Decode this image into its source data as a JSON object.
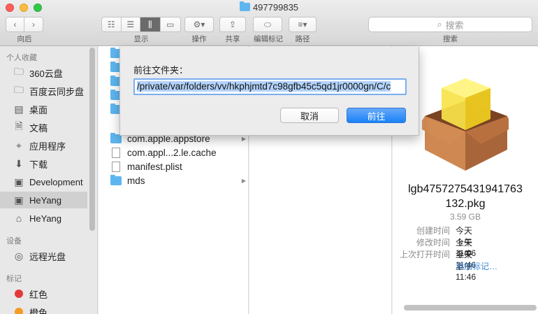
{
  "window": {
    "title": "497799835"
  },
  "toolbar": {
    "back_label": "向后",
    "view_label": "显示",
    "action_label": "操作",
    "share_label": "共享",
    "tags_label": "编辑标记",
    "path_label": "路径",
    "search_placeholder": "搜索",
    "search_label": "搜索"
  },
  "sidebar": {
    "favorites_header": "个人收藏",
    "favorites": [
      {
        "label": "360云盘",
        "icon": "folder-icon"
      },
      {
        "label": "百度云同步盘",
        "icon": "folder-icon"
      },
      {
        "label": "桌面",
        "icon": "desktop-icon"
      },
      {
        "label": "文稿",
        "icon": "documents-icon"
      },
      {
        "label": "应用程序",
        "icon": "applications-icon"
      },
      {
        "label": "下载",
        "icon": "downloads-icon"
      },
      {
        "label": "Development",
        "icon": "drive-icon"
      },
      {
        "label": "HeYang",
        "icon": "drive-icon",
        "selected": true
      },
      {
        "label": "HeYang",
        "icon": "home-icon"
      }
    ],
    "devices_header": "设备",
    "devices": [
      {
        "label": "远程光盘",
        "icon": "disc-icon"
      }
    ],
    "tags_header": "标记",
    "tags": [
      {
        "label": "红色",
        "color": "#e5383b"
      },
      {
        "label": "橙色",
        "color": "#f59a23"
      }
    ]
  },
  "column1": {
    "items": [
      {
        "label": "com.apple.appstore",
        "type": "folder",
        "has_children": true
      },
      {
        "label": "com.appl...2.le.cache",
        "type": "file"
      },
      {
        "label": "manifest.plist",
        "type": "file"
      },
      {
        "label": "mds",
        "type": "folder",
        "has_children": true
      }
    ]
  },
  "preview": {
    "name_line1": "lgb4757275431941763",
    "name_line2": "132.pkg",
    "size": "3.59 GB",
    "meta": [
      {
        "key": "创建时间",
        "value": "今天 上午11:06"
      },
      {
        "key": "修改时间",
        "value": "今天 上午11:46"
      },
      {
        "key": "上次打开时间",
        "value": "今天 上午11:46"
      }
    ],
    "add_tags": "添加标记…"
  },
  "dialog": {
    "label": "前往文件夹：",
    "path": "/private/var/folders/vv/hkphjmtd7c98gfb45c5qd1jr0000gn/C/c",
    "cancel": "取消",
    "go": "前往"
  },
  "colors": {
    "accent": "#1a82f7",
    "folder": "#5eb6f0",
    "selection": "#b3d3fb"
  }
}
